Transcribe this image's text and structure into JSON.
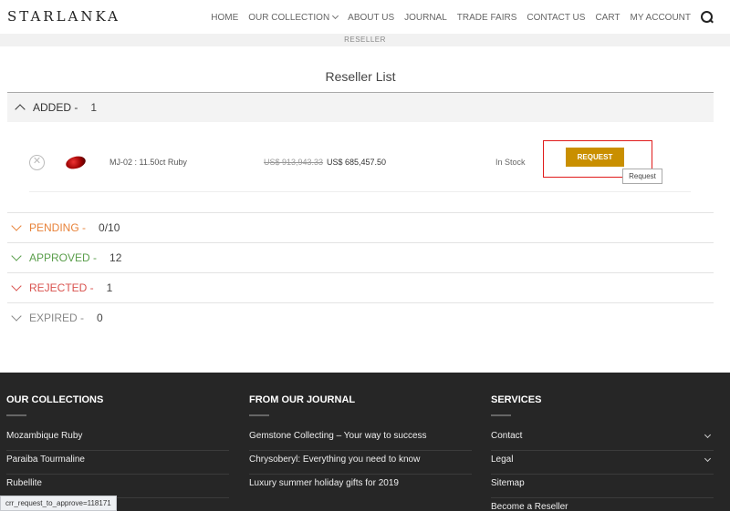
{
  "header": {
    "logo": "STARLANKA",
    "nav": [
      "HOME",
      "OUR COLLECTION",
      "ABOUT US",
      "JOURNAL",
      "TRADE FAIRS",
      "CONTACT US",
      "CART",
      "MY ACCOUNT"
    ]
  },
  "subbar": "RESELLER",
  "page_title": "Reseller List",
  "sections": {
    "added": {
      "label": "ADDED -",
      "count": "1"
    },
    "pending": {
      "label": "PENDING -",
      "count": "0/10",
      "color": "#e8833a"
    },
    "approved": {
      "label": "APPROVED -",
      "count": "12",
      "color": "#5a9e4b"
    },
    "rejected": {
      "label": "REJECTED -",
      "count": "1",
      "color": "#d9534f"
    },
    "expired": {
      "label": "EXPIRED -",
      "count": "0",
      "color": "#888888"
    }
  },
  "item": {
    "name": "MJ-02 : 11.50ct Ruby",
    "old_price": "US$ 913,943.33",
    "new_price": "US$ 685,457.50",
    "stock": "In Stock",
    "button": "REQUEST",
    "tooltip": "Request"
  },
  "footer": {
    "collections": {
      "title": "OUR COLLECTIONS",
      "links": [
        "Mozambique Ruby",
        "Paraiba Tourmaline",
        "Rubellite"
      ]
    },
    "journal": {
      "title": "FROM OUR JOURNAL",
      "links": [
        "Gemstone Collecting – Your way to success",
        "Chrysoberyl: Everything you need to know",
        "Luxury summer holiday gifts for 2019"
      ]
    },
    "services": {
      "title": "SERVICES",
      "links": [
        "Contact",
        "Legal",
        "Sitemap",
        "Become a Reseller"
      ]
    }
  },
  "status_url": "crr_request_to_approve=118171",
  "colors": {
    "accent_button": "#c98f00",
    "highlight": "#e01b1b",
    "footer_bg": "#262626"
  }
}
